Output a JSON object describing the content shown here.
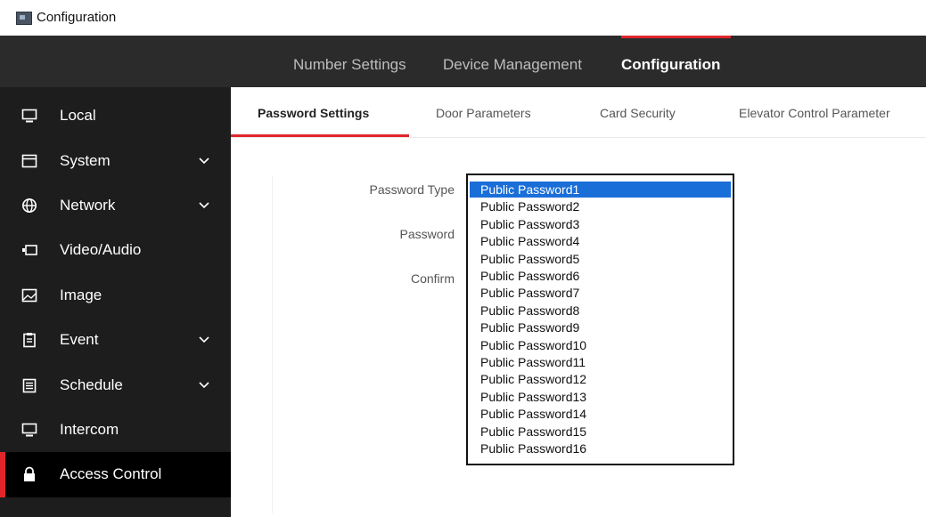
{
  "window": {
    "title": "Configuration"
  },
  "topnav": {
    "items": [
      {
        "label": "Number Settings",
        "active": false
      },
      {
        "label": "Device Management",
        "active": false
      },
      {
        "label": "Configuration",
        "active": true
      }
    ]
  },
  "sidebar": {
    "items": [
      {
        "label": "Local",
        "icon": "monitor-icon",
        "expandable": false
      },
      {
        "label": "System",
        "icon": "window-icon",
        "expandable": true
      },
      {
        "label": "Network",
        "icon": "globe-icon",
        "expandable": true
      },
      {
        "label": "Video/Audio",
        "icon": "video-audio-icon",
        "expandable": false
      },
      {
        "label": "Image",
        "icon": "image-icon",
        "expandable": false
      },
      {
        "label": "Event",
        "icon": "event-icon",
        "expandable": true
      },
      {
        "label": "Schedule",
        "icon": "schedule-icon",
        "expandable": true
      },
      {
        "label": "Intercom",
        "icon": "monitor-icon",
        "expandable": false
      },
      {
        "label": "Access Control",
        "icon": "lock-icon",
        "expandable": false,
        "active": true
      }
    ]
  },
  "tabs": [
    {
      "label": "Password Settings",
      "active": true
    },
    {
      "label": "Door Parameters",
      "active": false
    },
    {
      "label": "Card Security",
      "active": false
    },
    {
      "label": "Elevator Control Parameter",
      "active": false
    }
  ],
  "form": {
    "password_type_label": "Password Type",
    "password_label": "Password",
    "confirm_label": "Confirm",
    "password_type_options": [
      "Public Password1",
      "Public Password2",
      "Public Password3",
      "Public Password4",
      "Public Password5",
      "Public Password6",
      "Public Password7",
      "Public Password8",
      "Public Password9",
      "Public Password10",
      "Public Password11",
      "Public Password12",
      "Public Password13",
      "Public Password14",
      "Public Password15",
      "Public Password16"
    ],
    "selected_option": "Public Password1"
  },
  "colors": {
    "accent": "#e0262b",
    "selection": "#1a6ed8",
    "topnav_bg": "#2b2b2b",
    "sidebar_bg": "#1d1d1d"
  }
}
